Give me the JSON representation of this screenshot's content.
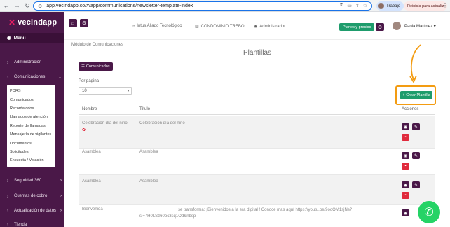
{
  "browser": {
    "url": "app.vecindapp.co/#/app/communications/newsletter-template-index",
    "profile_label": "Trabajo",
    "restart_label": "Reinicia para actualiz"
  },
  "sidebar": {
    "logo_text": "vecindapp",
    "menu_label": "Menu",
    "items": [
      {
        "label": "Administración"
      },
      {
        "label": "Comunicaciones"
      },
      {
        "label": "Seguridad 360"
      },
      {
        "label": "Cuentas de cobro"
      },
      {
        "label": "Actualización de datos"
      },
      {
        "label": "Tienda"
      }
    ],
    "submenu": [
      "PQRS",
      "Comunicados",
      "Recordatorios",
      "Llamados de atención",
      "Reporte de llamadas",
      "Mensajería de vigilantes",
      "Documentos",
      "Solicitudes",
      "Encuesta / Votación"
    ]
  },
  "header": {
    "company": "Intus Aliado Tecnológico",
    "condo": "CONDOMINIO TREBOL",
    "role": "Administrador",
    "plans_label": "Planes y precios",
    "user_name": "Paola Martinez"
  },
  "main": {
    "breadcrumb": "Módulo de Comunicaciones",
    "title": "Plantillas",
    "comunicados_label": "Comunicados",
    "per_page_label": "Por página",
    "per_page_value": "10",
    "create_label": "Crear Plantilla"
  },
  "table": {
    "headers": [
      "Nombre",
      "Título",
      "Acciones"
    ],
    "rows": [
      {
        "nombre": "Celebración día del niño",
        "titulo": "Celebración día del niño"
      },
      {
        "nombre": "Asamblea",
        "titulo": "Asamblea"
      },
      {
        "nombre": "Asamblea",
        "titulo": "Asamblea"
      },
      {
        "nombre": "Bienvenida",
        "titulo": "________________ se transforma: ¡Bienvenidos a la era digital ! Conoce mas aquí https://youtu.be/9ooOM1sjNs?si=7H0LSz60oc3sq1Od&nbsp"
      }
    ]
  },
  "colors": {
    "brand_purple": "#4a1848",
    "accent_green": "#1e9c6c",
    "highlight_orange": "#f39c12",
    "delete_red": "#e02a3c"
  }
}
